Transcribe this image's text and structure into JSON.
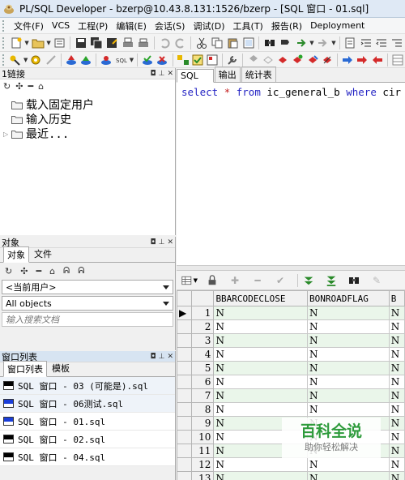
{
  "window": {
    "title": "PL/SQL Developer - bzerp@10.43.8.131:1526/bzerp - [SQL 窗口 - 01.sql]"
  },
  "menu": [
    "文件(F)",
    "VCS",
    "工程(P)",
    "编辑(E)",
    "会话(S)",
    "调试(D)",
    "工具(T)",
    "报告(R)",
    "Deployment"
  ],
  "connections_panel": {
    "title": "1链接",
    "tree": [
      {
        "label": "载入固定用户",
        "expandable": false
      },
      {
        "label": "输入历史",
        "expandable": false
      },
      {
        "label": "最近...",
        "expandable": true
      }
    ]
  },
  "objects_panel": {
    "title": "对象",
    "tabs": [
      "对象",
      "文件"
    ],
    "user_select": "<当前用户>",
    "objects_select": "All objects",
    "search_placeholder": "输入搜索文档"
  },
  "windows_panel": {
    "title": "窗口列表",
    "tabs": [
      "窗口列表",
      "模板"
    ],
    "items": [
      {
        "label": "SQL 窗口 - 03 (可能是).sql",
        "icon": "black",
        "highlight": true
      },
      {
        "label": "SQL 窗口 - 06测试.sql",
        "icon": "blue",
        "highlight": false
      },
      {
        "label": "SQL 窗口 - 01.sql",
        "icon": "blue",
        "highlight": false
      },
      {
        "label": "SQL 窗口 - 02.sql",
        "icon": "black",
        "highlight": false
      },
      {
        "label": "SQL 窗口 - 04.sql",
        "icon": "black",
        "highlight": false
      }
    ]
  },
  "editor": {
    "tabs": [
      "SQL",
      "输出",
      "统计表"
    ],
    "sql": {
      "select": "select",
      "star": "*",
      "from": "from",
      "table": "ic_general_b",
      "where": "where",
      "rest": "cir"
    }
  },
  "grid": {
    "columns": [
      "BBARCODECLOSE",
      "BONROADFLAG",
      "B"
    ],
    "rows": [
      {
        "n": "1",
        "c1": "N",
        "c2": "N",
        "c3": "N"
      },
      {
        "n": "2",
        "c1": "N",
        "c2": "N",
        "c3": "N"
      },
      {
        "n": "3",
        "c1": "N",
        "c2": "N",
        "c3": "N"
      },
      {
        "n": "4",
        "c1": "N",
        "c2": "N",
        "c3": "N"
      },
      {
        "n": "5",
        "c1": "N",
        "c2": "N",
        "c3": "N"
      },
      {
        "n": "6",
        "c1": "N",
        "c2": "N",
        "c3": "N"
      },
      {
        "n": "7",
        "c1": "N",
        "c2": "N",
        "c3": "N"
      },
      {
        "n": "8",
        "c1": "N",
        "c2": "N",
        "c3": "N"
      },
      {
        "n": "9",
        "c1": "N",
        "c2": "N",
        "c3": "N"
      },
      {
        "n": "10",
        "c1": "N",
        "c2": "N",
        "c3": "N"
      },
      {
        "n": "11",
        "c1": "N",
        "c2": "N",
        "c3": "N"
      },
      {
        "n": "12",
        "c1": "N",
        "c2": "N",
        "c3": "N"
      },
      {
        "n": "13",
        "c1": "N",
        "c2": "N",
        "c3": "N"
      }
    ]
  },
  "watermark": {
    "title": "百科全说",
    "subtitle": "助你轻松解决"
  }
}
